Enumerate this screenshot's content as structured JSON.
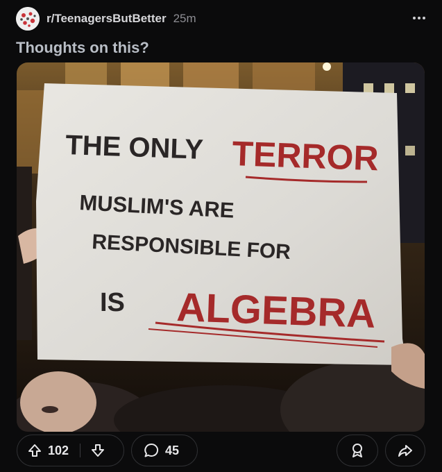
{
  "post": {
    "subreddit": "r/TeenagersButBetter",
    "time_ago": "25m",
    "title": "Thoughts on this?"
  },
  "sign": {
    "line1_part1": "THE ONLY",
    "line1_part2": "TERROR",
    "line2": "MUSLIM'S ARE",
    "line3": "RESPONSIBLE FOR",
    "line4_part1": "IS",
    "line4_part2": "ALGEBRA"
  },
  "actions": {
    "upvotes": "102",
    "comments": "45"
  },
  "colors": {
    "background": "#0b0b0c",
    "title": "#b9bec6",
    "sign_red": "#a52a2a",
    "sign_black": "#2a2626"
  }
}
